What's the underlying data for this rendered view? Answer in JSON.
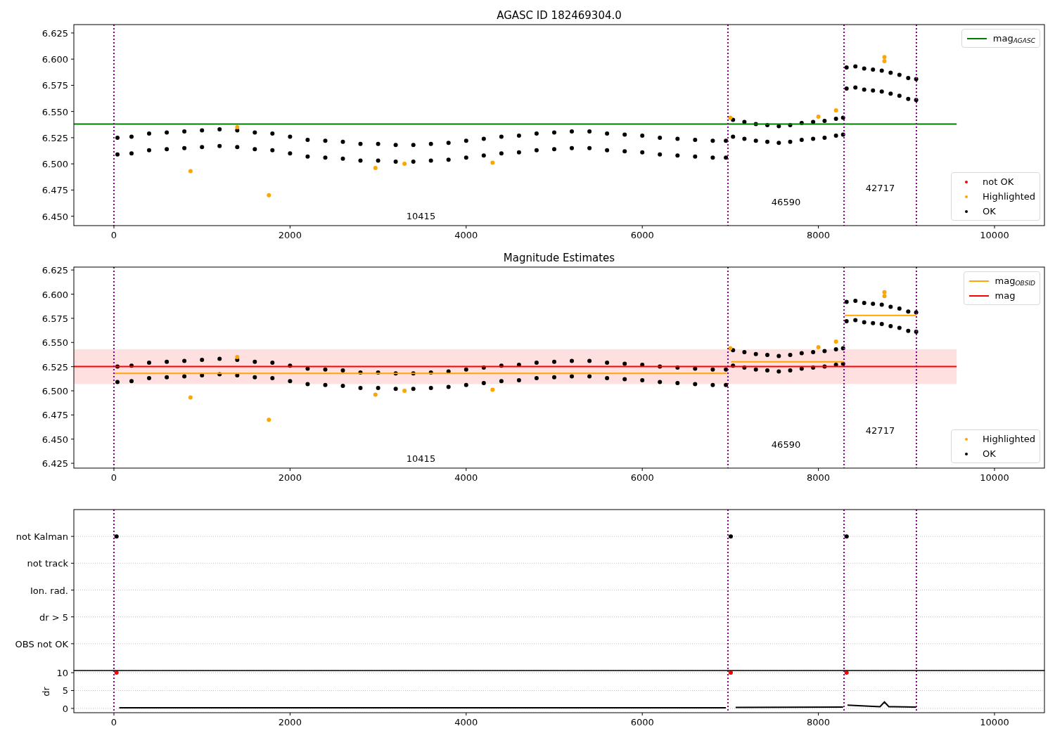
{
  "panels": [
    {
      "chart_data": {
        "type": "scatter",
        "title": "AGASC ID 182469304.0",
        "legend": [
          "upper right",
          "lower right"
        ],
        "xlim": [
          -455,
          10567
        ],
        "ylim": [
          6.441,
          6.633
        ],
        "xticks": [
          0,
          2000,
          4000,
          6000,
          8000,
          10000
        ],
        "yticks": [
          {
            "value": 6.45,
            "label": "6.450"
          },
          {
            "value": 6.475,
            "label": "6.475"
          },
          {
            "value": 6.5,
            "label": "6.500"
          },
          {
            "value": 6.525,
            "label": "6.525"
          },
          {
            "value": 6.55,
            "label": "6.550"
          },
          {
            "value": 6.575,
            "label": "6.575"
          },
          {
            "value": 6.6,
            "label": "6.600"
          },
          {
            "value": 6.625,
            "label": "6.625"
          }
        ],
        "series": [
          {
            "name": "mag$_{AGASC}$",
            "type": "line",
            "color": "#008000",
            "x": [
              -455,
              9570
            ],
            "values": [
              6.538,
              6.538
            ]
          },
          {
            "name": "not OK",
            "color": "#ff0000"
          },
          {
            "name": "Highlighted",
            "color": "#ffa500",
            "x": [
              870,
              1400,
              1760,
              2970,
              3300,
              4300,
              7000,
              8000,
              8200,
              8750,
              8750
            ],
            "values": [
              6.493,
              6.535,
              6.47,
              6.496,
              6.5,
              6.501,
              6.544,
              6.545,
              6.551,
              6.602,
              6.598
            ]
          },
          {
            "name": "OK",
            "color": "#000000",
            "x": [
              40,
              40,
              200,
              200,
              400,
              400,
              600,
              600,
              800,
              800,
              1000,
              1000,
              1200,
              1200,
              1400,
              1400,
              1600,
              1600,
              1800,
              1800,
              2000,
              2000,
              2200,
              2200,
              2400,
              2400,
              2600,
              2600,
              2800,
              2800,
              3000,
              3000,
              3200,
              3200,
              3400,
              3400,
              3600,
              3600,
              3800,
              3800,
              4000,
              4000,
              4200,
              4200,
              4400,
              4400,
              4600,
              4600,
              4800,
              4800,
              5000,
              5000,
              5200,
              5200,
              5400,
              5400,
              5600,
              5600,
              5800,
              5800,
              6000,
              6000,
              6200,
              6200,
              6400,
              6400,
              6600,
              6600,
              6800,
              6800,
              6950,
              6950,
              7030,
              7030,
              7160,
              7160,
              7290,
              7290,
              7420,
              7420,
              7550,
              7550,
              7680,
              7680,
              7810,
              7810,
              7940,
              7940,
              8070,
              8070,
              8200,
              8200,
              8280,
              8280,
              8320,
              8320,
              8420,
              8420,
              8520,
              8520,
              8620,
              8620,
              8720,
              8720,
              8820,
              8820,
              8920,
              8920,
              9020,
              9020,
              9110,
              9110
            ],
            "values": [
              6.509,
              6.525,
              6.51,
              6.526,
              6.513,
              6.529,
              6.514,
              6.53,
              6.515,
              6.531,
              6.516,
              6.532,
              6.517,
              6.533,
              6.516,
              6.532,
              6.514,
              6.53,
              6.513,
              6.529,
              6.51,
              6.526,
              6.507,
              6.523,
              6.506,
              6.522,
              6.505,
              6.521,
              6.503,
              6.519,
              6.503,
              6.519,
              6.502,
              6.518,
              6.502,
              6.518,
              6.503,
              6.519,
              6.504,
              6.52,
              6.506,
              6.522,
              6.508,
              6.524,
              6.51,
              6.526,
              6.511,
              6.527,
              6.513,
              6.529,
              6.514,
              6.53,
              6.515,
              6.531,
              6.515,
              6.531,
              6.513,
              6.529,
              6.512,
              6.528,
              6.511,
              6.527,
              6.509,
              6.525,
              6.508,
              6.524,
              6.507,
              6.523,
              6.506,
              6.522,
              6.506,
              6.522,
              6.526,
              6.542,
              6.524,
              6.54,
              6.522,
              6.538,
              6.521,
              6.537,
              6.52,
              6.536,
              6.521,
              6.537,
              6.523,
              6.539,
              6.524,
              6.54,
              6.525,
              6.541,
              6.527,
              6.543,
              6.528,
              6.544,
              6.572,
              6.592,
              6.573,
              6.593,
              6.571,
              6.591,
              6.57,
              6.59,
              6.569,
              6.589,
              6.567,
              6.587,
              6.565,
              6.585,
              6.562,
              6.582,
              6.561,
              6.581
            ]
          }
        ],
        "ref_lines": [
          {
            "axis": "x",
            "value": 0
          },
          {
            "axis": "x",
            "value": 6973
          },
          {
            "axis": "x",
            "value": 8291
          },
          {
            "axis": "x",
            "value": 9113
          }
        ],
        "annotations": [
          "10415",
          "46590",
          "42717"
        ]
      }
    },
    {
      "chart_data": {
        "type": "scatter",
        "title": "Magnitude Estimates",
        "legend": [
          "upper right",
          "lower right"
        ],
        "xlim": [
          -455,
          10567
        ],
        "ylim": [
          6.42,
          6.628
        ],
        "xticks": [
          0,
          2000,
          4000,
          6000,
          8000,
          10000
        ],
        "yticks": [
          {
            "value": 6.425,
            "label": "6.425"
          },
          {
            "value": 6.45,
            "label": "6.450"
          },
          {
            "value": 6.475,
            "label": "6.475"
          },
          {
            "value": 6.5,
            "label": "6.500"
          },
          {
            "value": 6.525,
            "label": "6.525"
          },
          {
            "value": 6.55,
            "label": "6.550"
          },
          {
            "value": 6.575,
            "label": "6.575"
          },
          {
            "value": 6.6,
            "label": "6.600"
          },
          {
            "value": 6.625,
            "label": "6.625"
          }
        ],
        "series": [
          {
            "name": "mag$_{OBSID}$",
            "type": "line",
            "color": "#ffa500",
            "x": [
              0,
              6960,
              6990,
              7010,
              8290,
              8295,
              8300,
              9110
            ],
            "values": [
              6.518,
              6.518,
              null,
              6.53,
              6.53,
              null,
              6.578,
              6.578
            ]
          },
          {
            "name": "mag",
            "type": "line",
            "color": "#ff0000",
            "x": [
              -455,
              9570
            ],
            "values": [
              6.525,
              6.525
            ]
          },
          {
            "name": "Highlighted",
            "color": "#ffa500",
            "x": [
              870,
              1400,
              1760,
              2970,
              3300,
              4300,
              7000,
              8000,
              8200,
              8750,
              8750
            ],
            "values": [
              6.493,
              6.535,
              6.47,
              6.496,
              6.5,
              6.501,
              6.544,
              6.545,
              6.551,
              6.602,
              6.598
            ]
          },
          {
            "name": "OK",
            "color": "#000000",
            "x": [
              40,
              40,
              200,
              200,
              400,
              400,
              600,
              600,
              800,
              800,
              1000,
              1000,
              1200,
              1200,
              1400,
              1400,
              1600,
              1600,
              1800,
              1800,
              2000,
              2000,
              2200,
              2200,
              2400,
              2400,
              2600,
              2600,
              2800,
              2800,
              3000,
              3000,
              3200,
              3200,
              3400,
              3400,
              3600,
              3600,
              3800,
              3800,
              4000,
              4000,
              4200,
              4200,
              4400,
              4400,
              4600,
              4600,
              4800,
              4800,
              5000,
              5000,
              5200,
              5200,
              5400,
              5400,
              5600,
              5600,
              5800,
              5800,
              6000,
              6000,
              6200,
              6200,
              6400,
              6400,
              6600,
              6600,
              6800,
              6800,
              6950,
              6950,
              7030,
              7030,
              7160,
              7160,
              7290,
              7290,
              7420,
              7420,
              7550,
              7550,
              7680,
              7680,
              7810,
              7810,
              7940,
              7940,
              8070,
              8070,
              8200,
              8200,
              8280,
              8280,
              8320,
              8320,
              8420,
              8420,
              8520,
              8520,
              8620,
              8620,
              8720,
              8720,
              8820,
              8820,
              8920,
              8920,
              9020,
              9020,
              9110,
              9110
            ],
            "values": [
              6.509,
              6.525,
              6.51,
              6.526,
              6.513,
              6.529,
              6.514,
              6.53,
              6.515,
              6.531,
              6.516,
              6.532,
              6.517,
              6.533,
              6.516,
              6.532,
              6.514,
              6.53,
              6.513,
              6.529,
              6.51,
              6.526,
              6.507,
              6.523,
              6.506,
              6.522,
              6.505,
              6.521,
              6.503,
              6.519,
              6.503,
              6.519,
              6.502,
              6.518,
              6.502,
              6.518,
              6.503,
              6.519,
              6.504,
              6.52,
              6.506,
              6.522,
              6.508,
              6.524,
              6.51,
              6.526,
              6.511,
              6.527,
              6.513,
              6.529,
              6.514,
              6.53,
              6.515,
              6.531,
              6.515,
              6.531,
              6.513,
              6.529,
              6.512,
              6.528,
              6.511,
              6.527,
              6.509,
              6.525,
              6.508,
              6.524,
              6.507,
              6.523,
              6.506,
              6.522,
              6.506,
              6.522,
              6.526,
              6.542,
              6.524,
              6.54,
              6.522,
              6.538,
              6.521,
              6.537,
              6.52,
              6.536,
              6.521,
              6.537,
              6.523,
              6.539,
              6.524,
              6.54,
              6.525,
              6.541,
              6.527,
              6.543,
              6.528,
              6.544,
              6.572,
              6.592,
              6.573,
              6.593,
              6.571,
              6.591,
              6.57,
              6.59,
              6.569,
              6.589,
              6.567,
              6.587,
              6.565,
              6.585,
              6.562,
              6.582,
              6.561,
              6.581
            ]
          }
        ],
        "ref_lines": [
          {
            "axis": "x",
            "value": 0
          },
          {
            "axis": "x",
            "value": 6973
          },
          {
            "axis": "x",
            "value": 8291
          },
          {
            "axis": "x",
            "value": 9113
          }
        ],
        "bands": [
          {
            "axis": "y",
            "from": 6.507,
            "to": 6.543
          }
        ],
        "annotations": [
          "10415",
          "46590",
          "42717"
        ]
      }
    },
    {
      "chart_data": {
        "type": "scatter",
        "orientation": "horizontal",
        "categories": [
          "not Kalman",
          "not track",
          "Ion. rad.",
          "dr > 5",
          "OBS not OK"
        ],
        "xlim": [
          -455,
          10567
        ],
        "grid": true,
        "series": [
          {
            "color": "#000000",
            "values": [
              30,
              null,
              null,
              null,
              null
            ]
          },
          {
            "color": "#000000",
            "values": [
              7005,
              null,
              null,
              null,
              null
            ]
          },
          {
            "color": "#000000",
            "values": [
              8320,
              null,
              null,
              null,
              null
            ]
          }
        ],
        "ref_lines": [
          {
            "axis": "x",
            "value": 0
          },
          {
            "axis": "x",
            "value": 6973
          },
          {
            "axis": "x",
            "value": 8291
          },
          {
            "axis": "x",
            "value": 9113
          }
        ]
      }
    },
    {
      "chart_data": {
        "type": "scatter",
        "ylabel": "dr",
        "xlim": [
          -455,
          10567
        ],
        "ylim": [
          -1.2,
          10.6
        ],
        "grid": true,
        "xticks": [
          0,
          2000,
          4000,
          6000,
          8000,
          10000
        ],
        "yticks": [
          0,
          5,
          10
        ],
        "series": [
          {
            "color": "#ff0000",
            "x": [
              30,
              7005,
              8320
            ],
            "values": [
              10,
              10,
              10
            ]
          },
          {
            "type": "line",
            "color": "#000000",
            "x": [
              60,
              6950,
              7000,
              7060,
              8280,
              8300,
              8330,
              8700,
              8750,
              8800,
              9110
            ],
            "values": [
              0.2,
              0.2,
              null,
              0.3,
              0.4,
              null,
              0.9,
              0.5,
              1.8,
              0.5,
              0.4
            ]
          }
        ],
        "ref_lines": [
          {
            "axis": "x",
            "value": 0
          },
          {
            "axis": "x",
            "value": 6973
          },
          {
            "axis": "x",
            "value": 8291
          },
          {
            "axis": "x",
            "value": 9113
          }
        ]
      }
    }
  ]
}
